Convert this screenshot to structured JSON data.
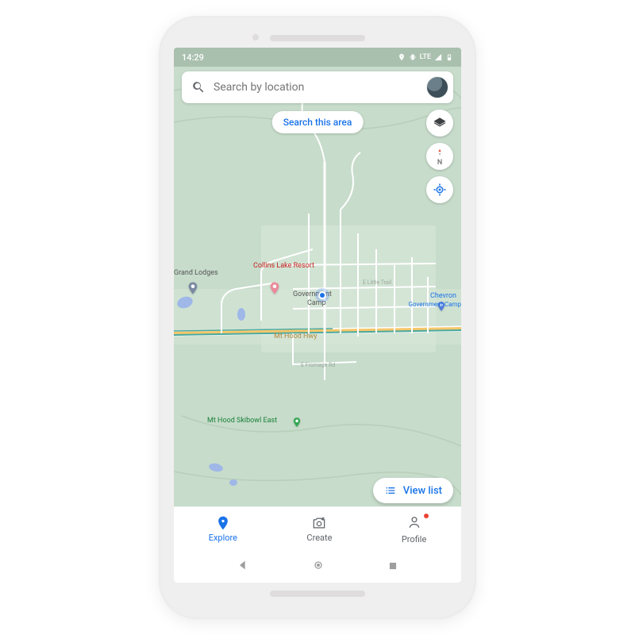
{
  "status": {
    "time": "14:29",
    "network": "LTE"
  },
  "search": {
    "placeholder": "Search by location"
  },
  "chip": {
    "label": "Search this area"
  },
  "fabs": {
    "layers": "layers",
    "north": "N",
    "locate": "locate"
  },
  "viewlist": {
    "label": "View list"
  },
  "nav": {
    "explore": "Explore",
    "create": "Create",
    "profile": "Profile"
  },
  "map": {
    "highway": "Mt Hood Hwy",
    "places": {
      "grand_lodges": "Grand Lodges",
      "collins_lake": "Collins Lake Resort",
      "gov_camp1": "Government",
      "gov_camp2": "Camp",
      "chevron1": "Chevron",
      "chevron2": "Government Camp",
      "skibowl": "Mt Hood Skibowl East",
      "fromage": "E Fromage Rd",
      "little_trail": "E Little Trail"
    }
  }
}
